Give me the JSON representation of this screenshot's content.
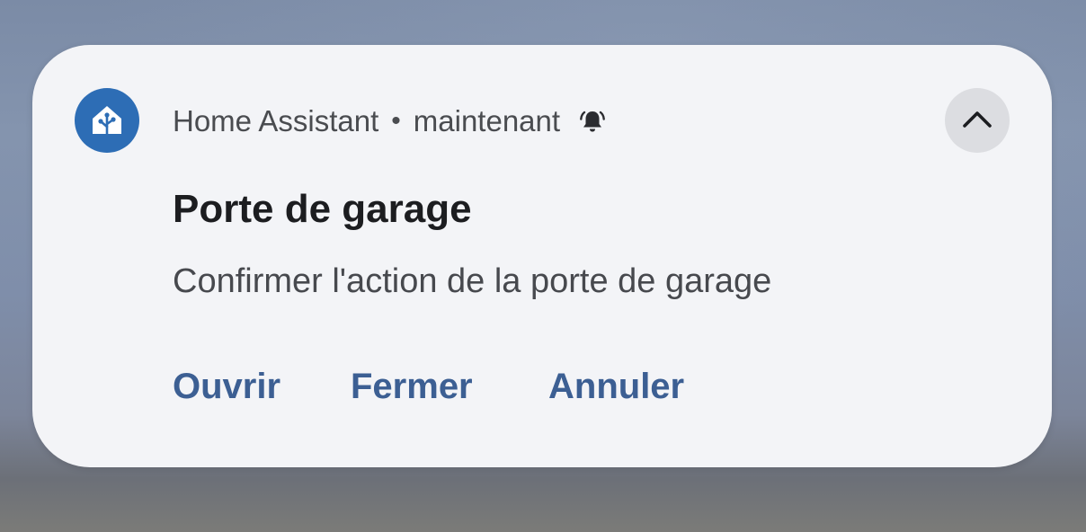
{
  "notification": {
    "app_name": "Home Assistant",
    "separator": "•",
    "time": "maintenant",
    "app_icon": "home-assistant-icon",
    "alert_icon": "bell-ringing-icon",
    "collapse_icon": "chevron-up-icon",
    "title": "Porte de garage",
    "message": "Confirmer l'action de la porte de garage",
    "actions": [
      {
        "label": "Ouvrir"
      },
      {
        "label": "Fermer"
      },
      {
        "label": "Annuler"
      }
    ]
  },
  "colors": {
    "app_icon_bg": "#2d6db5",
    "action_text": "#3c5f93",
    "card_bg": "#f3f4f7"
  }
}
